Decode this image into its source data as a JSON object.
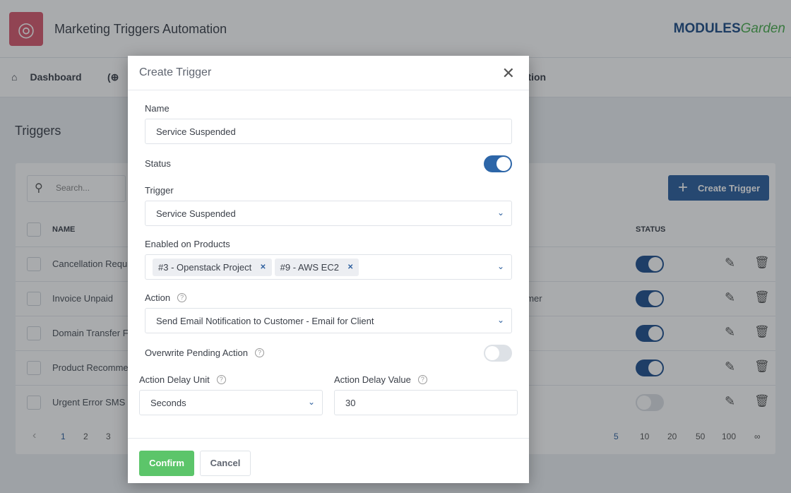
{
  "app": {
    "title": "Marketing Triggers Automation",
    "brand_bold": "MODULES",
    "brand_light": "Garden"
  },
  "nav": {
    "dashboard": "Dashboard",
    "documentation_partial": "tation"
  },
  "page": {
    "title": "Triggers",
    "search_placeholder": "Search...",
    "create_button": "Create Trigger"
  },
  "table": {
    "col_name": "NAME",
    "col_status": "STATUS",
    "rows": [
      {
        "name": "Cancellation Requ",
        "extra": "",
        "enabled": true
      },
      {
        "name": "Invoice Unpaid",
        "extra": "omer",
        "enabled": true
      },
      {
        "name": "Domain Transfer F",
        "extra": "",
        "enabled": true
      },
      {
        "name": "Product Recomme",
        "extra": "",
        "enabled": true
      },
      {
        "name": "Urgent Error SMS",
        "extra": "",
        "enabled": false
      }
    ]
  },
  "pagination": {
    "pages": [
      "1",
      "2",
      "3"
    ],
    "page_sizes": [
      "5",
      "10",
      "20",
      "50",
      "100",
      "∞"
    ],
    "current_page": "1",
    "current_size": "5"
  },
  "modal": {
    "title": "Create Trigger",
    "name_label": "Name",
    "name_value": "Service Suspended",
    "status_label": "Status",
    "status_on": true,
    "trigger_label": "Trigger",
    "trigger_value": "Service Suspended",
    "products_label": "Enabled on Products",
    "products": [
      "#3 - Openstack Project",
      "#9 - AWS EC2"
    ],
    "action_label": "Action",
    "action_value": "Send Email Notification to Customer - Email for Client",
    "overwrite_label": "Overwrite Pending Action",
    "overwrite_on": false,
    "delay_unit_label": "Action Delay Unit",
    "delay_unit_value": "Seconds",
    "delay_value_label": "Action Delay Value",
    "delay_value": "30",
    "confirm": "Confirm",
    "cancel": "Cancel"
  },
  "colors": {
    "primary": "#2d5f9e",
    "confirm": "#5cc56a",
    "logo": "#d95a6e"
  }
}
